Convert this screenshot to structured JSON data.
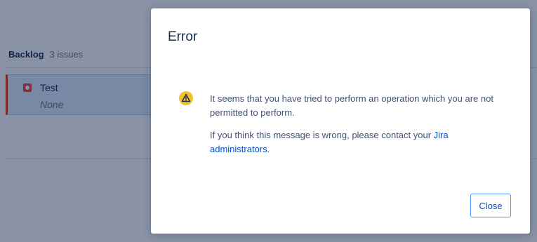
{
  "background": {
    "backlog": {
      "title": "Backlog",
      "count": "3 issues"
    },
    "issue": {
      "summary": "Test",
      "epic": "None",
      "type_icon": "bug-icon"
    }
  },
  "dialog": {
    "title": "Error",
    "icon": "warning-icon",
    "message_line1": "It seems that you have tried to perform an operation which you are not permitted to perform.",
    "message_line2_prefix": "If you think this message is wrong, please contact your ",
    "message_link": "Jira administrators",
    "message_line2_suffix": ".",
    "close_label": "Close"
  },
  "colors": {
    "link": "#0052cc",
    "warning": "#ffc400",
    "overlay": "#091e42",
    "issue_bug": "#e5493a"
  }
}
